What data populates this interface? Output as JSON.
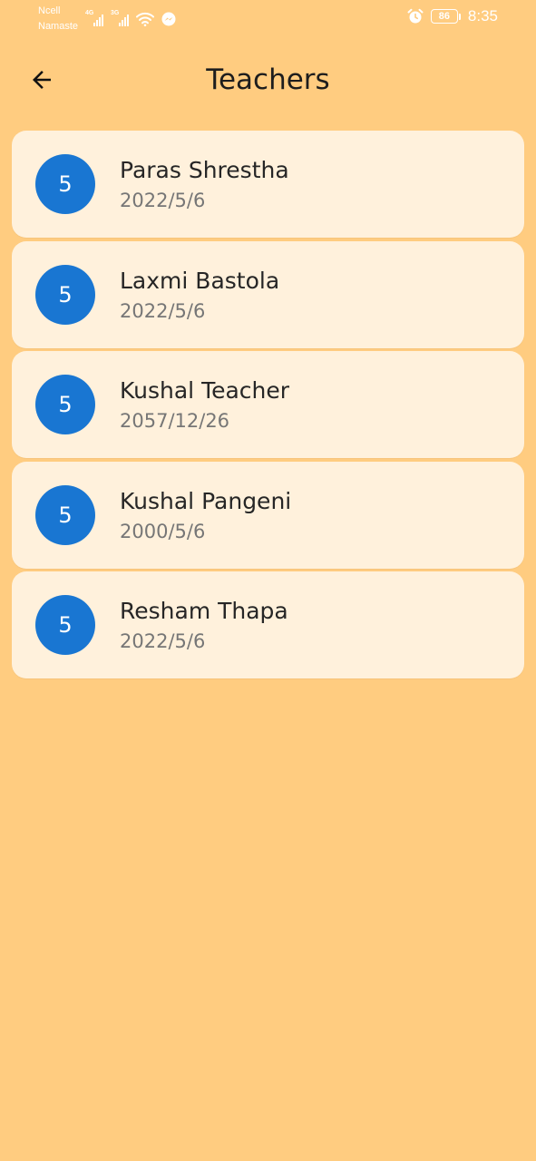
{
  "status_bar": {
    "carrier_line1": "Ncell",
    "carrier_line2": "Namaste",
    "net1": "4G",
    "net2": "3G",
    "battery": "86",
    "time": "8:35"
  },
  "header": {
    "title": "Teachers",
    "back_icon": "arrow-back-icon"
  },
  "teachers": [
    {
      "avatar": "5",
      "name": "Paras Shrestha",
      "date": "2022/5/6"
    },
    {
      "avatar": "5",
      "name": "Laxmi Bastola",
      "date": "2022/5/6"
    },
    {
      "avatar": "5",
      "name": "Kushal Teacher",
      "date": "2057/12/26"
    },
    {
      "avatar": "5",
      "name": "Kushal Pangeni",
      "date": "2000/5/6"
    },
    {
      "avatar": "5",
      "name": "Resham Thapa",
      "date": "2022/5/6"
    }
  ],
  "colors": {
    "background": "#FFCC80",
    "card": "#FFF1DC",
    "avatar": "#1976D2"
  }
}
